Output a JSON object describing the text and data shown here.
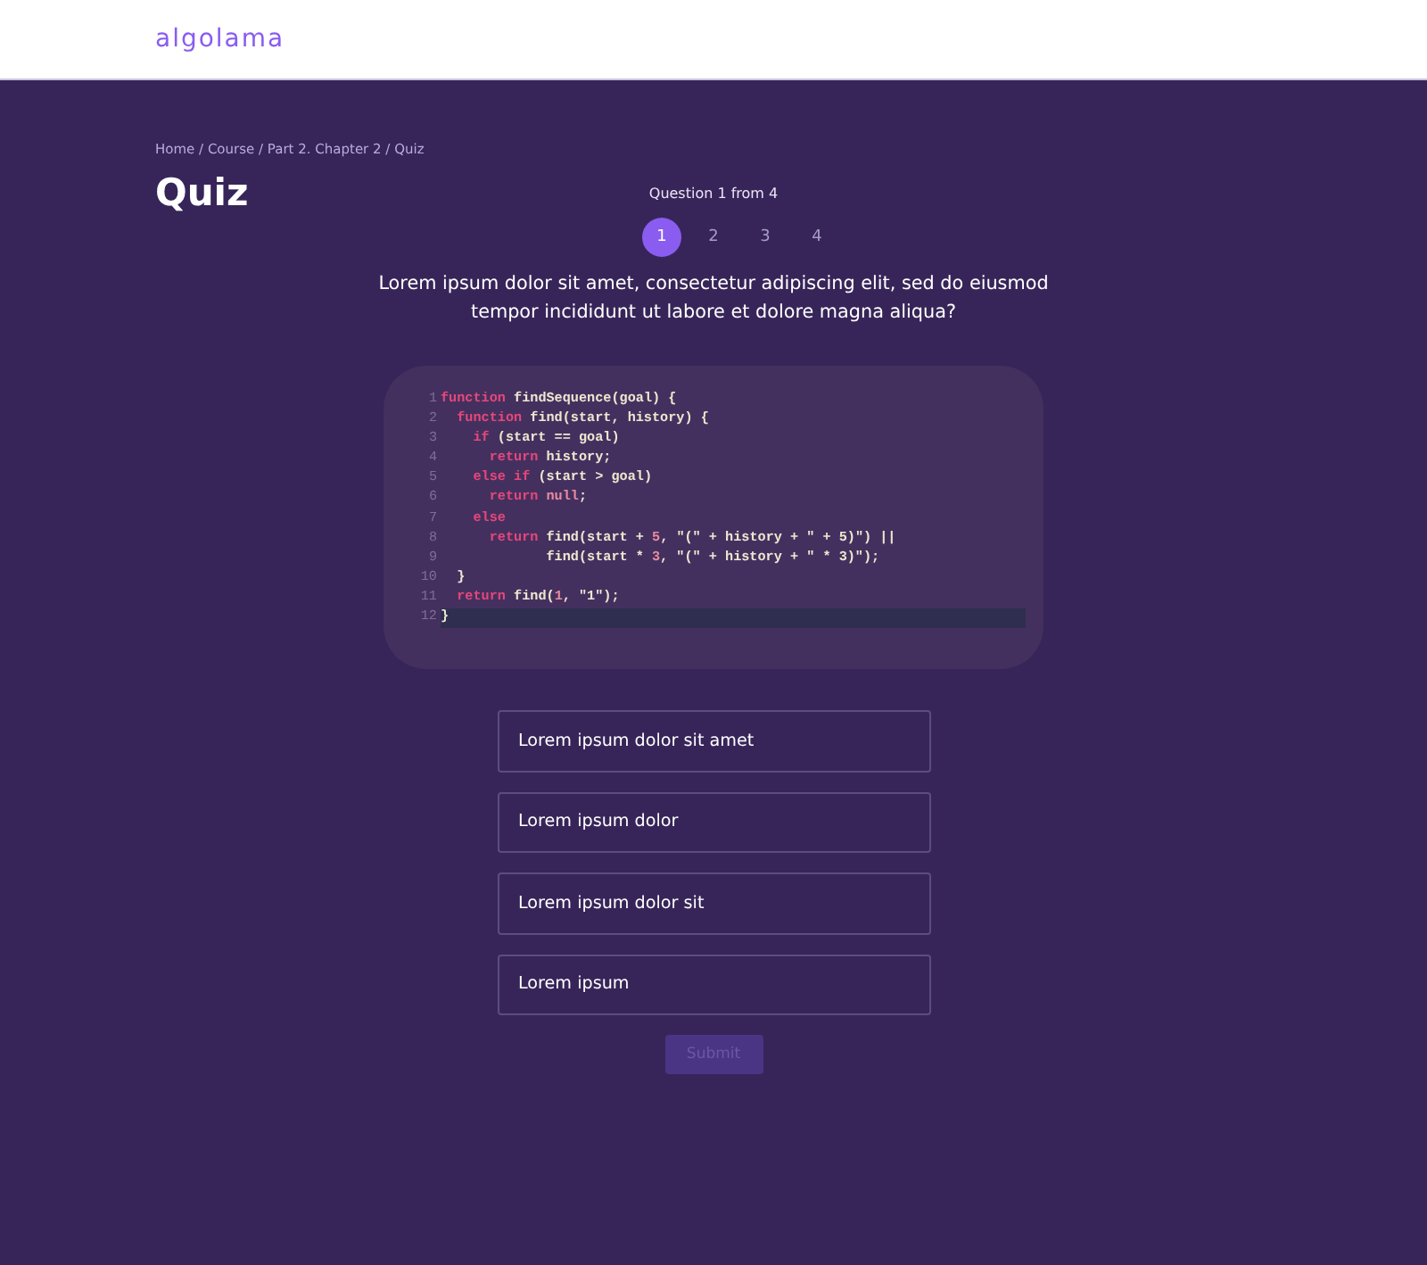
{
  "header": {
    "logo": "algolama"
  },
  "breadcrumb": "Home / Course /  Part 2. Chapter 2 / Quiz",
  "title": "Quiz",
  "progress": {
    "label": "Question 1 from 4",
    "pages": [
      {
        "label": "1",
        "selected": true
      },
      {
        "label": "2",
        "selected": false
      },
      {
        "label": "3",
        "selected": false
      },
      {
        "label": "4",
        "selected": false
      }
    ]
  },
  "question": "Lorem ipsum dolor sit amet, consectetur adipiscing elit, sed do eiusmod tempor incididunt ut labore et dolore magna aliqua?",
  "code": [
    {
      "number": "1",
      "highlighted": false,
      "tokens": [
        {
          "kind": "kw",
          "text": "function"
        },
        {
          "kind": "id",
          "text": " findSequence(goal) {"
        }
      ]
    },
    {
      "number": "2",
      "highlighted": false,
      "tokens": [
        {
          "kind": "kw",
          "text": "  function"
        },
        {
          "kind": "id",
          "text": " find(start, history) {"
        }
      ]
    },
    {
      "number": "3",
      "highlighted": false,
      "tokens": [
        {
          "kind": "kw",
          "text": "    if"
        },
        {
          "kind": "id",
          "text": " (start == goal)"
        }
      ]
    },
    {
      "number": "4",
      "highlighted": false,
      "tokens": [
        {
          "kind": "kw",
          "text": "      return"
        },
        {
          "kind": "id",
          "text": " history;"
        }
      ]
    },
    {
      "number": "5",
      "highlighted": false,
      "tokens": [
        {
          "kind": "kw",
          "text": "    else if"
        },
        {
          "kind": "id",
          "text": " (start > goal)"
        }
      ]
    },
    {
      "number": "6",
      "highlighted": false,
      "tokens": [
        {
          "kind": "kw",
          "text": "      return"
        },
        {
          "kind": "num",
          "text": " null"
        },
        {
          "kind": "id",
          "text": ";"
        }
      ]
    },
    {
      "number": "7",
      "highlighted": false,
      "tokens": [
        {
          "kind": "kw",
          "text": "    else"
        }
      ]
    },
    {
      "number": "8",
      "highlighted": false,
      "tokens": [
        {
          "kind": "kw",
          "text": "      return"
        },
        {
          "kind": "id",
          "text": " find(start + "
        },
        {
          "kind": "num",
          "text": "5"
        },
        {
          "kind": "id",
          "text": ", "
        },
        {
          "kind": "str",
          "text": "\"(\""
        },
        {
          "kind": "id",
          "text": " + history + "
        },
        {
          "kind": "str",
          "text": "\" + 5)\""
        },
        {
          "kind": "id",
          "text": ") ||"
        }
      ]
    },
    {
      "number": "9",
      "highlighted": false,
      "tokens": [
        {
          "kind": "id",
          "text": "             find(start * "
        },
        {
          "kind": "num",
          "text": "3"
        },
        {
          "kind": "id",
          "text": ", "
        },
        {
          "kind": "str",
          "text": "\"(\""
        },
        {
          "kind": "id",
          "text": " + history + "
        },
        {
          "kind": "str",
          "text": "\" * 3)\""
        },
        {
          "kind": "id",
          "text": ");"
        }
      ]
    },
    {
      "number": "10",
      "highlighted": false,
      "tokens": [
        {
          "kind": "id",
          "text": "  }"
        }
      ]
    },
    {
      "number": "11",
      "highlighted": false,
      "tokens": [
        {
          "kind": "kw",
          "text": "  return"
        },
        {
          "kind": "id",
          "text": " find("
        },
        {
          "kind": "num",
          "text": "1"
        },
        {
          "kind": "id",
          "text": ", "
        },
        {
          "kind": "str",
          "text": "\"1\""
        },
        {
          "kind": "id",
          "text": ");"
        }
      ]
    },
    {
      "number": "12",
      "highlighted": true,
      "tokens": [
        {
          "kind": "id",
          "text": "}"
        }
      ]
    }
  ],
  "answers": [
    {
      "label": "Lorem ipsum dolor sit amet",
      "selected": false
    },
    {
      "label": "Lorem ipsum dolor",
      "selected": false
    },
    {
      "label": "Lorem ipsum dolor sit",
      "selected": false
    },
    {
      "label": "Lorem ipsum",
      "selected": false
    }
  ],
  "submit": {
    "label": "Submit",
    "disabled": true
  }
}
